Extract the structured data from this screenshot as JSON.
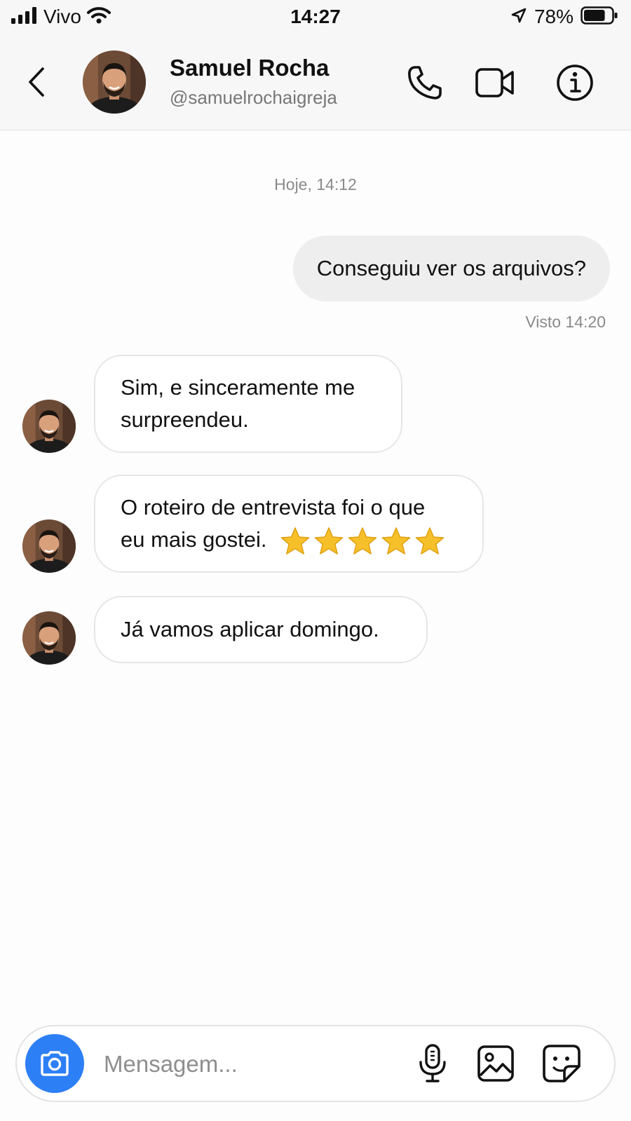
{
  "status_bar": {
    "carrier": "Vivo",
    "time": "14:27",
    "battery": "78%",
    "battery_level": 0.78
  },
  "header": {
    "name": "Samuel Rocha",
    "handle": "@samuelrochaigreja"
  },
  "messages": {
    "date_separator": "Hoje, 14:12",
    "outgoing": {
      "text": "Conseguiu ver os arquivos?",
      "seen": "Visto 14:20"
    },
    "incoming": [
      {
        "line1": "Sim, e sinceramente me",
        "line2": "surpreendeu."
      },
      {
        "line1": "O roteiro de entrevista foi o que",
        "line2": "eu mais gostei.",
        "stars": 5
      },
      {
        "line1": "Já vamos aplicar domingo."
      }
    ]
  },
  "composer": {
    "placeholder": "Mensagem..."
  },
  "colors": {
    "accent": "#2d7ff5",
    "star": "#f6c02b"
  },
  "icons": [
    "signal-icon",
    "wifi-icon",
    "location-icon",
    "battery-icon",
    "back-icon",
    "phone-icon",
    "video-icon",
    "info-icon",
    "camera-icon",
    "microphone-icon",
    "gallery-icon",
    "sticker-icon",
    "star-icon"
  ]
}
